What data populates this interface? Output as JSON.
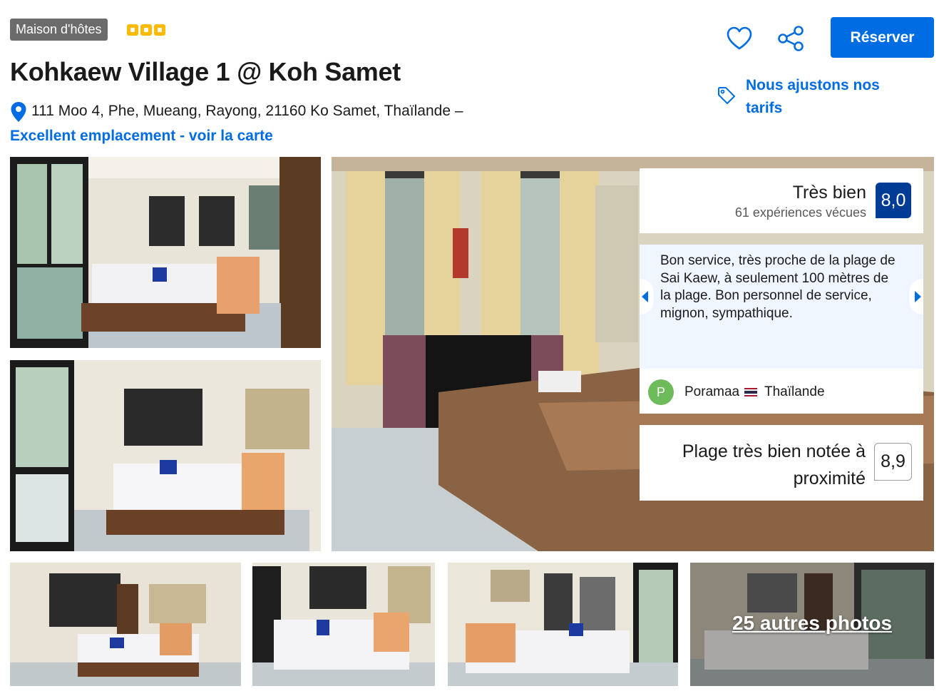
{
  "header": {
    "property_type": "Maison d'hôtes",
    "star_count": 3,
    "title": "Kohkaew Village 1 @ Koh Samet",
    "address": "111 Moo 4, Phe, Mueang, Rayong, 21160 Ko Samet, Thaïlande –",
    "map_link": "Excellent emplacement - voir la carte"
  },
  "actions": {
    "favorite_icon": "heart-icon",
    "share_icon": "share-icon",
    "reserve_label": "Réserver",
    "pricing_icon": "price-tag-icon",
    "pricing_label": "Nous ajustons nos tarifs"
  },
  "rating": {
    "label": "Très bien",
    "count": "61 expériences vécues",
    "score": "8,0"
  },
  "review": {
    "text": "Bon service, très proche de la plage de Sai Kaew, à seulement 100 mètres de la plage. Bon personnel de service, mignon, sympathique.",
    "avatar_letter": "P",
    "reviewer": "Poramaa",
    "country": "Thaïlande"
  },
  "beach": {
    "label": "Plage très bien notée à proximité",
    "score": "8,9"
  },
  "gallery": {
    "more_photos": "25 autres photos"
  },
  "colors": {
    "brand_blue": "#006ce4",
    "dark_blue": "#003b95",
    "star_yellow": "#febb02",
    "avatar_green": "#6dbb5a"
  }
}
